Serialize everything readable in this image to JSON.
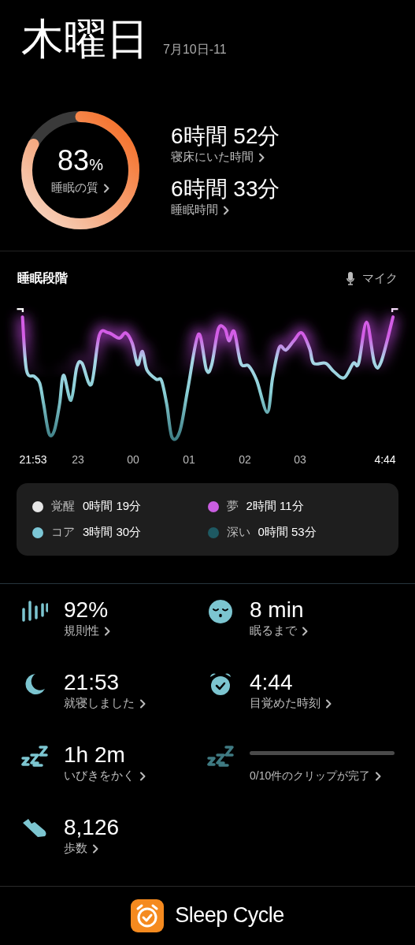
{
  "header": {
    "day": "木曜日",
    "date": "7月10日-11"
  },
  "quality": {
    "level": 0.83,
    "percent": "83",
    "unit": "%",
    "label": "睡眠の質"
  },
  "durations": [
    {
      "value": "6時間 52分",
      "label": "寝床にいた時間"
    },
    {
      "value": "6時間 33分",
      "label": "睡眠時間"
    }
  ],
  "stages": {
    "title": "睡眠段階",
    "source": "マイク",
    "time_labels": [
      "21:53",
      "23",
      "00",
      "01",
      "02",
      "03",
      "4:44"
    ]
  },
  "legend": [
    {
      "name": "覚醒",
      "value": "0時間 19分",
      "color": "#e6e6e6"
    },
    {
      "name": "夢",
      "value": "2時間 11分",
      "color": "#c95ee0"
    },
    {
      "name": "コア",
      "value": "3時間 30分",
      "color": "#7cc7d6"
    },
    {
      "name": "深い",
      "value": "0時間 53分",
      "color": "#1e5962"
    }
  ],
  "metrics": [
    {
      "kind": "stat",
      "value": "92%",
      "label": "規則性"
    },
    {
      "kind": "stat",
      "value": "8 min",
      "label": "眠るまで"
    },
    {
      "kind": "stat",
      "value": "21:53",
      "label": "就寝しました"
    },
    {
      "kind": "stat",
      "value": "4:44",
      "label": "目覚めた時刻"
    },
    {
      "kind": "stat",
      "value": "1h  2m",
      "label": "いびきをかく"
    },
    {
      "kind": "progress",
      "level": 0,
      "label": "0/10件のクリップが完了"
    },
    {
      "kind": "stat",
      "value": "8,126",
      "label": "歩数"
    }
  ],
  "footer": {
    "app_name": "Sleep Cycle"
  }
}
